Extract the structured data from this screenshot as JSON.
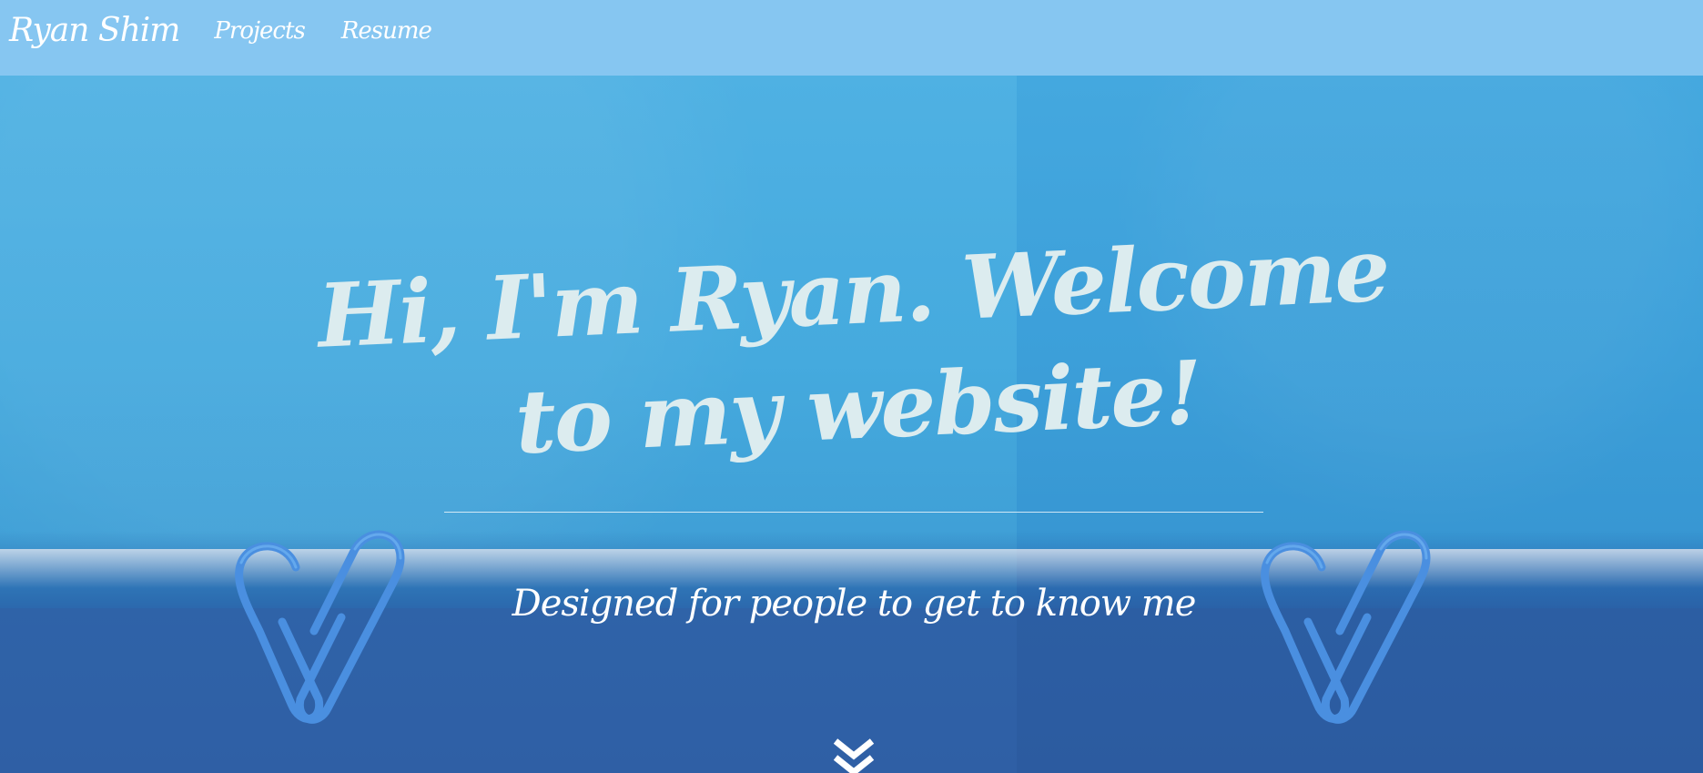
{
  "navbar": {
    "brand": "Ryan Shim",
    "links": [
      {
        "label": "Projects"
      },
      {
        "label": "Resume"
      }
    ],
    "background_color": "#86c6f1"
  },
  "hero": {
    "headline": "Hi, I'm Ryan. Welcome to my website!",
    "subtitle": "Designed for people to get to know me",
    "scroll_icon": "double-chevron-down-icon",
    "headline_color": "#dcecef",
    "background_image": "blue paper with paperclip hearts"
  }
}
